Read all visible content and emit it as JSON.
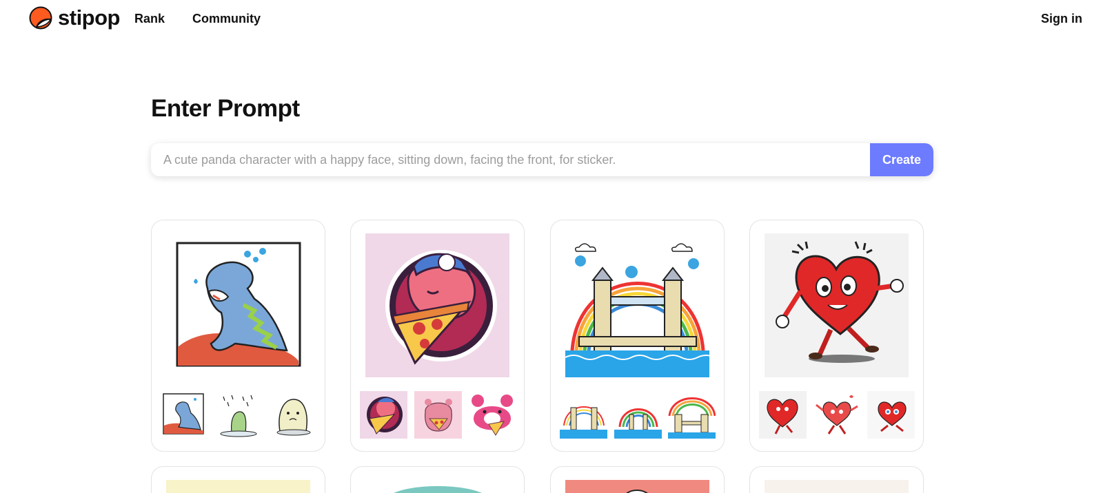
{
  "header": {
    "logo_text": "stipop",
    "nav": [
      {
        "label": "Rank"
      },
      {
        "label": "Community"
      }
    ],
    "sign_in_label": "Sign in"
  },
  "main": {
    "title": "Enter Prompt",
    "prompt": {
      "value": "",
      "placeholder": "A cute panda character with a happy face, sitting down, facing the front, for sticker."
    },
    "create_label": "Create"
  },
  "cards": [
    {
      "subject": "crying dinosaur sticker",
      "thumbnails": [
        "crying-dinosaur",
        "dinosaur-in-rain",
        "sad-ghost-dinosaur"
      ]
    },
    {
      "subject": "bear eating pizza sticker",
      "thumbnails": [
        "bear-with-pizza",
        "bear-holding-pizza",
        "pink-bear-with-pizza"
      ]
    },
    {
      "subject": "tower bridge with rainbow sticker",
      "thumbnails": [
        "tower-bridge-clouds",
        "bridge-rainbow",
        "rainbow-tower-bridge"
      ]
    },
    {
      "subject": "walking heart character sticker",
      "thumbnails": [
        "heart-running",
        "heart-dancing",
        "heart-jumping"
      ]
    }
  ],
  "colors": {
    "brand": "#ff5a1f",
    "accent": "#6d7bff"
  }
}
